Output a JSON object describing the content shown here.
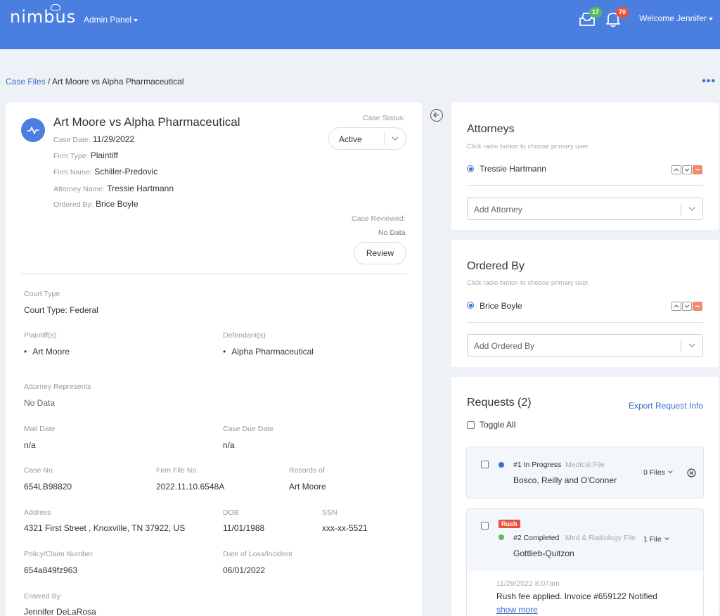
{
  "header": {
    "logo": "nimbus",
    "admin_panel": "Admin Panel",
    "mail_count": "17",
    "bell_count": "70",
    "welcome": "Welcome Jennifer",
    "colors": {
      "bar": "#4a7fe0",
      "mail_badge": "#5cb85c",
      "bell_badge": "#e8533a"
    }
  },
  "breadcrumb": {
    "root": "Case Files",
    "separator": " / ",
    "current": "Art Moore vs Alpha Pharmaceutical"
  },
  "case": {
    "title": "Art Moore vs Alpha Pharmaceutical",
    "case_date_label": "Case Date:",
    "case_date": "11/29/2022",
    "firm_type_label": "Firm Type:",
    "firm_type": "Plaintiff",
    "firm_name_label": "Firm Name:",
    "firm_name": "Schiller-Predovic",
    "attorney_name_label": "Attorney Name:",
    "attorney_name": "Tressie Hartmann",
    "ordered_by_label": "Ordered By:",
    "ordered_by": "Brice Boyle",
    "status_label": "Case Status:",
    "status": "Active",
    "reviewed_label": "Case Reviewed:",
    "reviewed": "No Data",
    "review_button": "Review"
  },
  "details": {
    "court_type_label": "Court Type",
    "court_type": "Court Type: Federal",
    "plaintiffs_label": "Plaintiff(s)",
    "plaintiffs": [
      "Art Moore"
    ],
    "defendants_label": "Defendant(s)",
    "defendants": [
      "Alpha Pharmaceutical"
    ],
    "attorney_represents_label": "Attorney Represents",
    "attorney_represents": "No Data",
    "mail_date_label": "Mail Date",
    "mail_date": "n/a",
    "case_due_date_label": "Case Due Date",
    "case_due_date": "n/a",
    "case_no_label": "Case No.",
    "case_no": "654LB98820",
    "firm_file_no_label": "Firm File No.",
    "firm_file_no": "2022.11.10.6548A",
    "records_of_label": "Records of",
    "records_of": "Art Moore",
    "address_label": "Address",
    "address": "4321 First Street , Knoxville, TN 37922, US",
    "dob_label": "DOB",
    "dob": "11/01/1988",
    "ssn_label": "SSN",
    "ssn": "xxx-xx-5521",
    "policy_label": "Policy/Claim Number",
    "policy": "654a849fz963",
    "date_of_loss_label": "Date of Loss/Incident",
    "date_of_loss": "06/01/2022",
    "entered_by_label": "Entered By",
    "entered_by": "Jennifer DeLaRosa"
  },
  "attorneys": {
    "title": "Attorneys",
    "hint": "Click radio button to choose primary user.",
    "primary": "Tressie Hartmann",
    "add_placeholder": "Add Attorney"
  },
  "ordered_by_card": {
    "title": "Ordered By",
    "hint": "Click radio button to choose primary user.",
    "primary": "Brice Boyle",
    "add_placeholder": "Add Ordered By"
  },
  "requests": {
    "title": "Requests (2)",
    "export": "Export Request Info",
    "toggle_all": "Toggle All",
    "items": [
      {
        "status": "#1 In Progress",
        "type": "Medical File",
        "name": "Bosco, Reilly and O'Conner",
        "files": "0 Files",
        "dot_color": "#3a6fd0"
      },
      {
        "rush": "Rush",
        "status": "#2 Completed",
        "type": "Med & Radiology File",
        "name": "Gottlieb-Quitzon",
        "files": "1 File",
        "dot_color": "#5cb85c",
        "note_time": "11/29/2022 8:07am",
        "note_text": "Rush fee applied. Invoice #659122 Notified",
        "show_more": "show more"
      }
    ]
  }
}
